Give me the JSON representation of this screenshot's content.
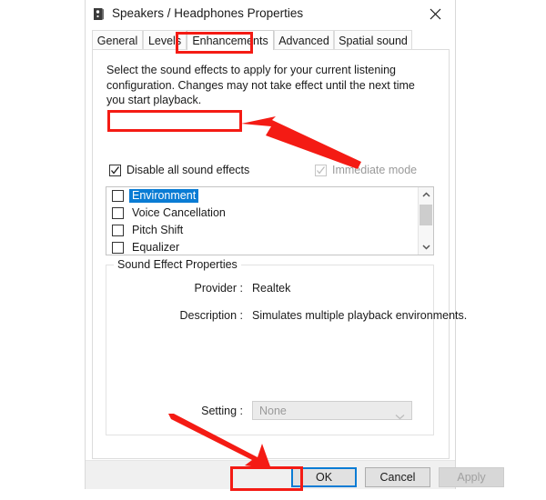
{
  "window": {
    "title": "Speakers / Headphones Properties",
    "icon": "speaker-device-icon",
    "close_label": "✕"
  },
  "tabs": [
    {
      "label": "General",
      "active": false
    },
    {
      "label": "Levels",
      "active": false
    },
    {
      "label": "Enhancements",
      "active": true
    },
    {
      "label": "Advanced",
      "active": false
    },
    {
      "label": "Spatial sound",
      "active": false
    }
  ],
  "main": {
    "intro": "Select the sound effects to apply for your current listening configuration. Changes may not take effect until the next time you start playback.",
    "disable_all": {
      "label": "Disable all sound effects",
      "checked": true,
      "enabled": true
    },
    "immediate_mode": {
      "label": "Immediate mode",
      "checked": true,
      "enabled": false
    }
  },
  "effects_list": [
    {
      "label": "Environment",
      "checked": false,
      "selected": true
    },
    {
      "label": "Voice Cancellation",
      "checked": false,
      "selected": false
    },
    {
      "label": "Pitch Shift",
      "checked": false,
      "selected": false
    },
    {
      "label": "Equalizer",
      "checked": false,
      "selected": false
    }
  ],
  "properties": {
    "group_title": "Sound Effect Properties",
    "provider_label": "Provider :",
    "provider_value": "Realtek",
    "description_label": "Description :",
    "description_value": "Simulates multiple playback environments.",
    "setting_label": "Setting :",
    "setting_value": "None",
    "setting_enabled": false
  },
  "footer": {
    "ok": "OK",
    "cancel": "Cancel",
    "apply": "Apply",
    "apply_enabled": false
  },
  "annotations": {
    "highlight_color": "#f41b14",
    "selection_color": "#0a7cd4",
    "boxes": [
      "enhancements-tab",
      "disable-all-sound-effects",
      "ok-button"
    ],
    "arrows": [
      "arrow-to-disable-checkbox",
      "arrow-to-ok-button"
    ]
  }
}
